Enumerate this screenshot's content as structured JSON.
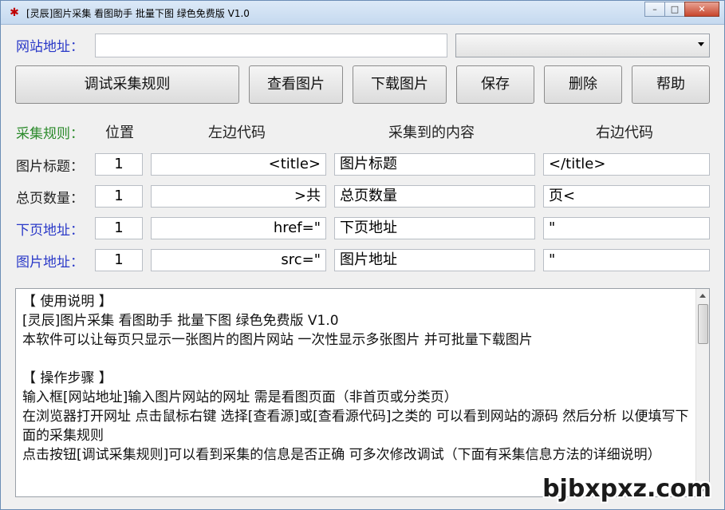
{
  "window": {
    "title": "[灵辰]图片采集 看图助手 批量下图 绿色免费版 V1.0",
    "icon": "app-logo-icon"
  },
  "url_row": {
    "label": "网站地址：",
    "value": "",
    "combo_value": ""
  },
  "toolbar": {
    "debug": "调试采集规则",
    "view": "查看图片",
    "download": "下载图片",
    "save": "保存",
    "delete": "删除",
    "help": "帮助"
  },
  "rules": {
    "header": {
      "label": "采集规则：",
      "position": "位置",
      "left_code": "左边代码",
      "content": "采集到的内容",
      "right_code": "右边代码"
    },
    "rows": [
      {
        "label": "图片标题：",
        "position": "1",
        "left": "<title>",
        "content": "图片标题",
        "right": "</title>"
      },
      {
        "label": "总页数量：",
        "position": "1",
        "left": ">共",
        "content": "总页数量",
        "right": "页<"
      },
      {
        "label": "下页地址：",
        "position": "1",
        "left": "href=\"",
        "content": "下页地址",
        "right": "\""
      },
      {
        "label": "图片地址：",
        "position": "1",
        "left": "src=\"",
        "content": "图片地址",
        "right": "\""
      }
    ]
  },
  "instructions": [
    "【 使用说明 】",
    "[灵辰]图片采集 看图助手 批量下图 绿色免费版 V1.0",
    "本软件可以让每页只显示一张图片的图片网站 一次性显示多张图片 并可批量下载图片",
    "",
    "【 操作步骤 】",
    "输入框[网站地址]输入图片网站的网址 需是看图页面（非首页或分类页）",
    "在浏览器打开网址 点击鼠标右键 选择[查看源]或[查看源代码]之类的 可以看到网站的源码 然后分析 以便填写下面的采集规则",
    "点击按钮[调试采集规则]可以看到采集的信息是否正确 可多次修改调试（下面有采集信息方法的详细说明）"
  ],
  "watermark": "bjbxpxz.com",
  "colors": {
    "blue_label": "#2a39c8",
    "green_label": "#2b8a2b"
  }
}
